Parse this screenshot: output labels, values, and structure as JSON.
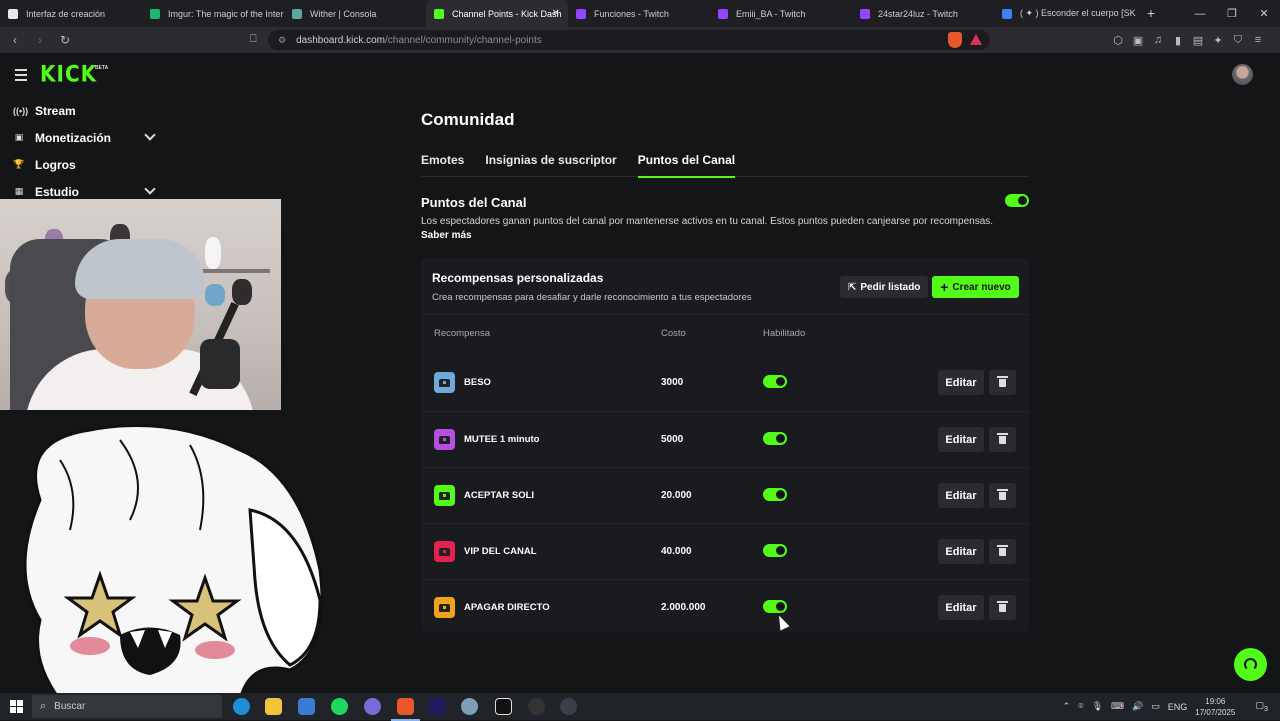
{
  "browser": {
    "tabs": [
      {
        "title": "Interfaz de creación",
        "color": "#e8e8e8"
      },
      {
        "title": "Imgur: The magic of the Intern",
        "color": "#1bb76e"
      },
      {
        "title": "Wither | Consola",
        "color": "#5aa6a2"
      },
      {
        "title": "Channel Points - Kick Dash",
        "color": "#53fc18"
      },
      {
        "title": "Funciones - Twitch",
        "color": "#9146ff"
      },
      {
        "title": "Emiii_BA - Twitch",
        "color": "#9146ff"
      },
      {
        "title": "24star24luz - Twitch",
        "color": "#9146ff"
      },
      {
        "title": "( ✦ ) Esconder el cuerpo [SKIN",
        "color": "#3b82f6"
      }
    ],
    "active_tab_index": 3,
    "url_domain": "dashboard.kick.com",
    "url_path": "/channel/community/channel-points"
  },
  "header": {
    "logo": "KICK",
    "logo_badge": "BETA"
  },
  "sidebar": {
    "items": [
      {
        "label": "Stream",
        "icon": "((•))",
        "has_chevron": false
      },
      {
        "label": "Monetización",
        "icon": "▣",
        "has_chevron": true
      },
      {
        "label": "Logros",
        "icon": "🏆",
        "has_chevron": false
      },
      {
        "label": "Estudio",
        "icon": "▦",
        "has_chevron": true
      }
    ]
  },
  "page": {
    "title": "Comunidad",
    "tabs": [
      "Emotes",
      "Insignias de suscriptor",
      "Puntos del Canal"
    ],
    "active_tab_index": 2
  },
  "channel_points": {
    "title": "Puntos del Canal",
    "description": "Los espectadores ganan puntos del canal por mantenerse activos en tu canal. Estos puntos pueden canjearse por recompensas.",
    "learn_more": "Saber más",
    "enabled": true
  },
  "rewards": {
    "title": "Recompensas personalizadas",
    "subtitle": "Crea recompensas para desafiar y darle reconocimiento a tus espectadores",
    "request_list_label": "Pedir listado",
    "create_new_label": "Crear nuevo",
    "columns": [
      "Recompensa",
      "Costo",
      "Habilitado"
    ],
    "edit_label": "Editar",
    "rows": [
      {
        "name": "BESO",
        "cost": "3000",
        "enabled": true,
        "color": "#6fa8dc"
      },
      {
        "name": "MUTEE 1 minuto",
        "cost": "5000",
        "enabled": true,
        "color": "#b44fe0"
      },
      {
        "name": "ACEPTAR SOLI",
        "cost": "20.000",
        "enabled": true,
        "color": "#53fc18"
      },
      {
        "name": "VIP DEL CANAL",
        "cost": "40.000",
        "enabled": true,
        "color": "#e0244f"
      },
      {
        "name": "APAGAR DIRECTO",
        "cost": "2.000.000",
        "enabled": true,
        "color": "#f0a21c"
      }
    ]
  },
  "taskbar": {
    "search_placeholder": "Buscar",
    "language": "ENG",
    "time": "19:06",
    "date": "17/07/2025",
    "notifications": "3"
  }
}
